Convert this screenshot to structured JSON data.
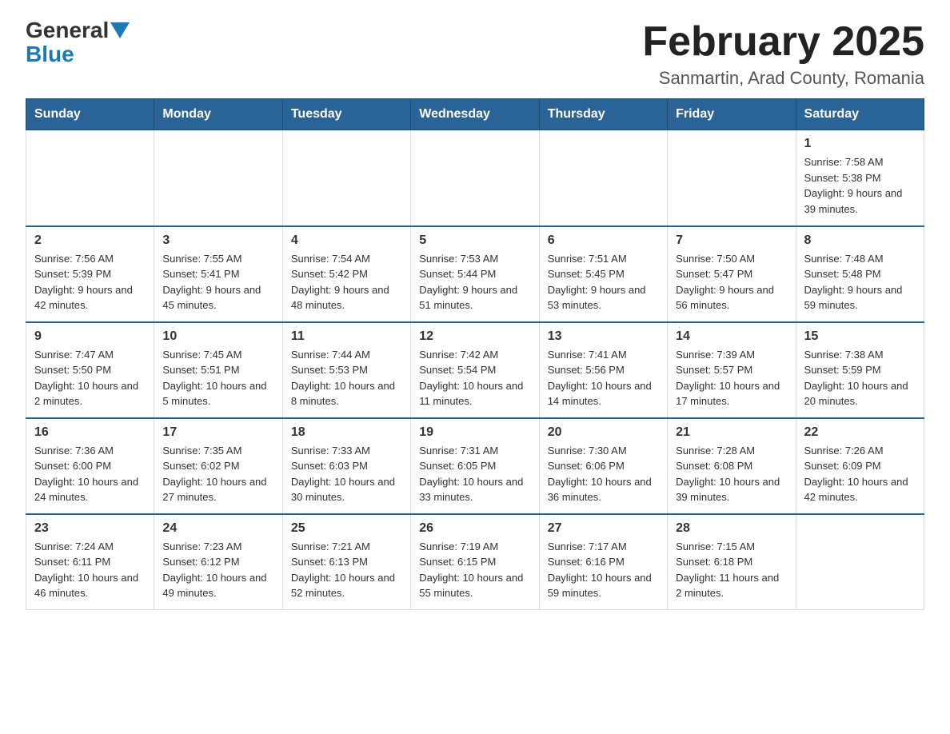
{
  "logo": {
    "part1": "General",
    "part2": "Blue"
  },
  "header": {
    "title": "February 2025",
    "subtitle": "Sanmartin, Arad County, Romania"
  },
  "weekdays": [
    "Sunday",
    "Monday",
    "Tuesday",
    "Wednesday",
    "Thursday",
    "Friday",
    "Saturday"
  ],
  "weeks": [
    [
      {
        "day": "",
        "info": ""
      },
      {
        "day": "",
        "info": ""
      },
      {
        "day": "",
        "info": ""
      },
      {
        "day": "",
        "info": ""
      },
      {
        "day": "",
        "info": ""
      },
      {
        "day": "",
        "info": ""
      },
      {
        "day": "1",
        "info": "Sunrise: 7:58 AM\nSunset: 5:38 PM\nDaylight: 9 hours and 39 minutes."
      }
    ],
    [
      {
        "day": "2",
        "info": "Sunrise: 7:56 AM\nSunset: 5:39 PM\nDaylight: 9 hours and 42 minutes."
      },
      {
        "day": "3",
        "info": "Sunrise: 7:55 AM\nSunset: 5:41 PM\nDaylight: 9 hours and 45 minutes."
      },
      {
        "day": "4",
        "info": "Sunrise: 7:54 AM\nSunset: 5:42 PM\nDaylight: 9 hours and 48 minutes."
      },
      {
        "day": "5",
        "info": "Sunrise: 7:53 AM\nSunset: 5:44 PM\nDaylight: 9 hours and 51 minutes."
      },
      {
        "day": "6",
        "info": "Sunrise: 7:51 AM\nSunset: 5:45 PM\nDaylight: 9 hours and 53 minutes."
      },
      {
        "day": "7",
        "info": "Sunrise: 7:50 AM\nSunset: 5:47 PM\nDaylight: 9 hours and 56 minutes."
      },
      {
        "day": "8",
        "info": "Sunrise: 7:48 AM\nSunset: 5:48 PM\nDaylight: 9 hours and 59 minutes."
      }
    ],
    [
      {
        "day": "9",
        "info": "Sunrise: 7:47 AM\nSunset: 5:50 PM\nDaylight: 10 hours and 2 minutes."
      },
      {
        "day": "10",
        "info": "Sunrise: 7:45 AM\nSunset: 5:51 PM\nDaylight: 10 hours and 5 minutes."
      },
      {
        "day": "11",
        "info": "Sunrise: 7:44 AM\nSunset: 5:53 PM\nDaylight: 10 hours and 8 minutes."
      },
      {
        "day": "12",
        "info": "Sunrise: 7:42 AM\nSunset: 5:54 PM\nDaylight: 10 hours and 11 minutes."
      },
      {
        "day": "13",
        "info": "Sunrise: 7:41 AM\nSunset: 5:56 PM\nDaylight: 10 hours and 14 minutes."
      },
      {
        "day": "14",
        "info": "Sunrise: 7:39 AM\nSunset: 5:57 PM\nDaylight: 10 hours and 17 minutes."
      },
      {
        "day": "15",
        "info": "Sunrise: 7:38 AM\nSunset: 5:59 PM\nDaylight: 10 hours and 20 minutes."
      }
    ],
    [
      {
        "day": "16",
        "info": "Sunrise: 7:36 AM\nSunset: 6:00 PM\nDaylight: 10 hours and 24 minutes."
      },
      {
        "day": "17",
        "info": "Sunrise: 7:35 AM\nSunset: 6:02 PM\nDaylight: 10 hours and 27 minutes."
      },
      {
        "day": "18",
        "info": "Sunrise: 7:33 AM\nSunset: 6:03 PM\nDaylight: 10 hours and 30 minutes."
      },
      {
        "day": "19",
        "info": "Sunrise: 7:31 AM\nSunset: 6:05 PM\nDaylight: 10 hours and 33 minutes."
      },
      {
        "day": "20",
        "info": "Sunrise: 7:30 AM\nSunset: 6:06 PM\nDaylight: 10 hours and 36 minutes."
      },
      {
        "day": "21",
        "info": "Sunrise: 7:28 AM\nSunset: 6:08 PM\nDaylight: 10 hours and 39 minutes."
      },
      {
        "day": "22",
        "info": "Sunrise: 7:26 AM\nSunset: 6:09 PM\nDaylight: 10 hours and 42 minutes."
      }
    ],
    [
      {
        "day": "23",
        "info": "Sunrise: 7:24 AM\nSunset: 6:11 PM\nDaylight: 10 hours and 46 minutes."
      },
      {
        "day": "24",
        "info": "Sunrise: 7:23 AM\nSunset: 6:12 PM\nDaylight: 10 hours and 49 minutes."
      },
      {
        "day": "25",
        "info": "Sunrise: 7:21 AM\nSunset: 6:13 PM\nDaylight: 10 hours and 52 minutes."
      },
      {
        "day": "26",
        "info": "Sunrise: 7:19 AM\nSunset: 6:15 PM\nDaylight: 10 hours and 55 minutes."
      },
      {
        "day": "27",
        "info": "Sunrise: 7:17 AM\nSunset: 6:16 PM\nDaylight: 10 hours and 59 minutes."
      },
      {
        "day": "28",
        "info": "Sunrise: 7:15 AM\nSunset: 6:18 PM\nDaylight: 11 hours and 2 minutes."
      },
      {
        "day": "",
        "info": ""
      }
    ]
  ]
}
